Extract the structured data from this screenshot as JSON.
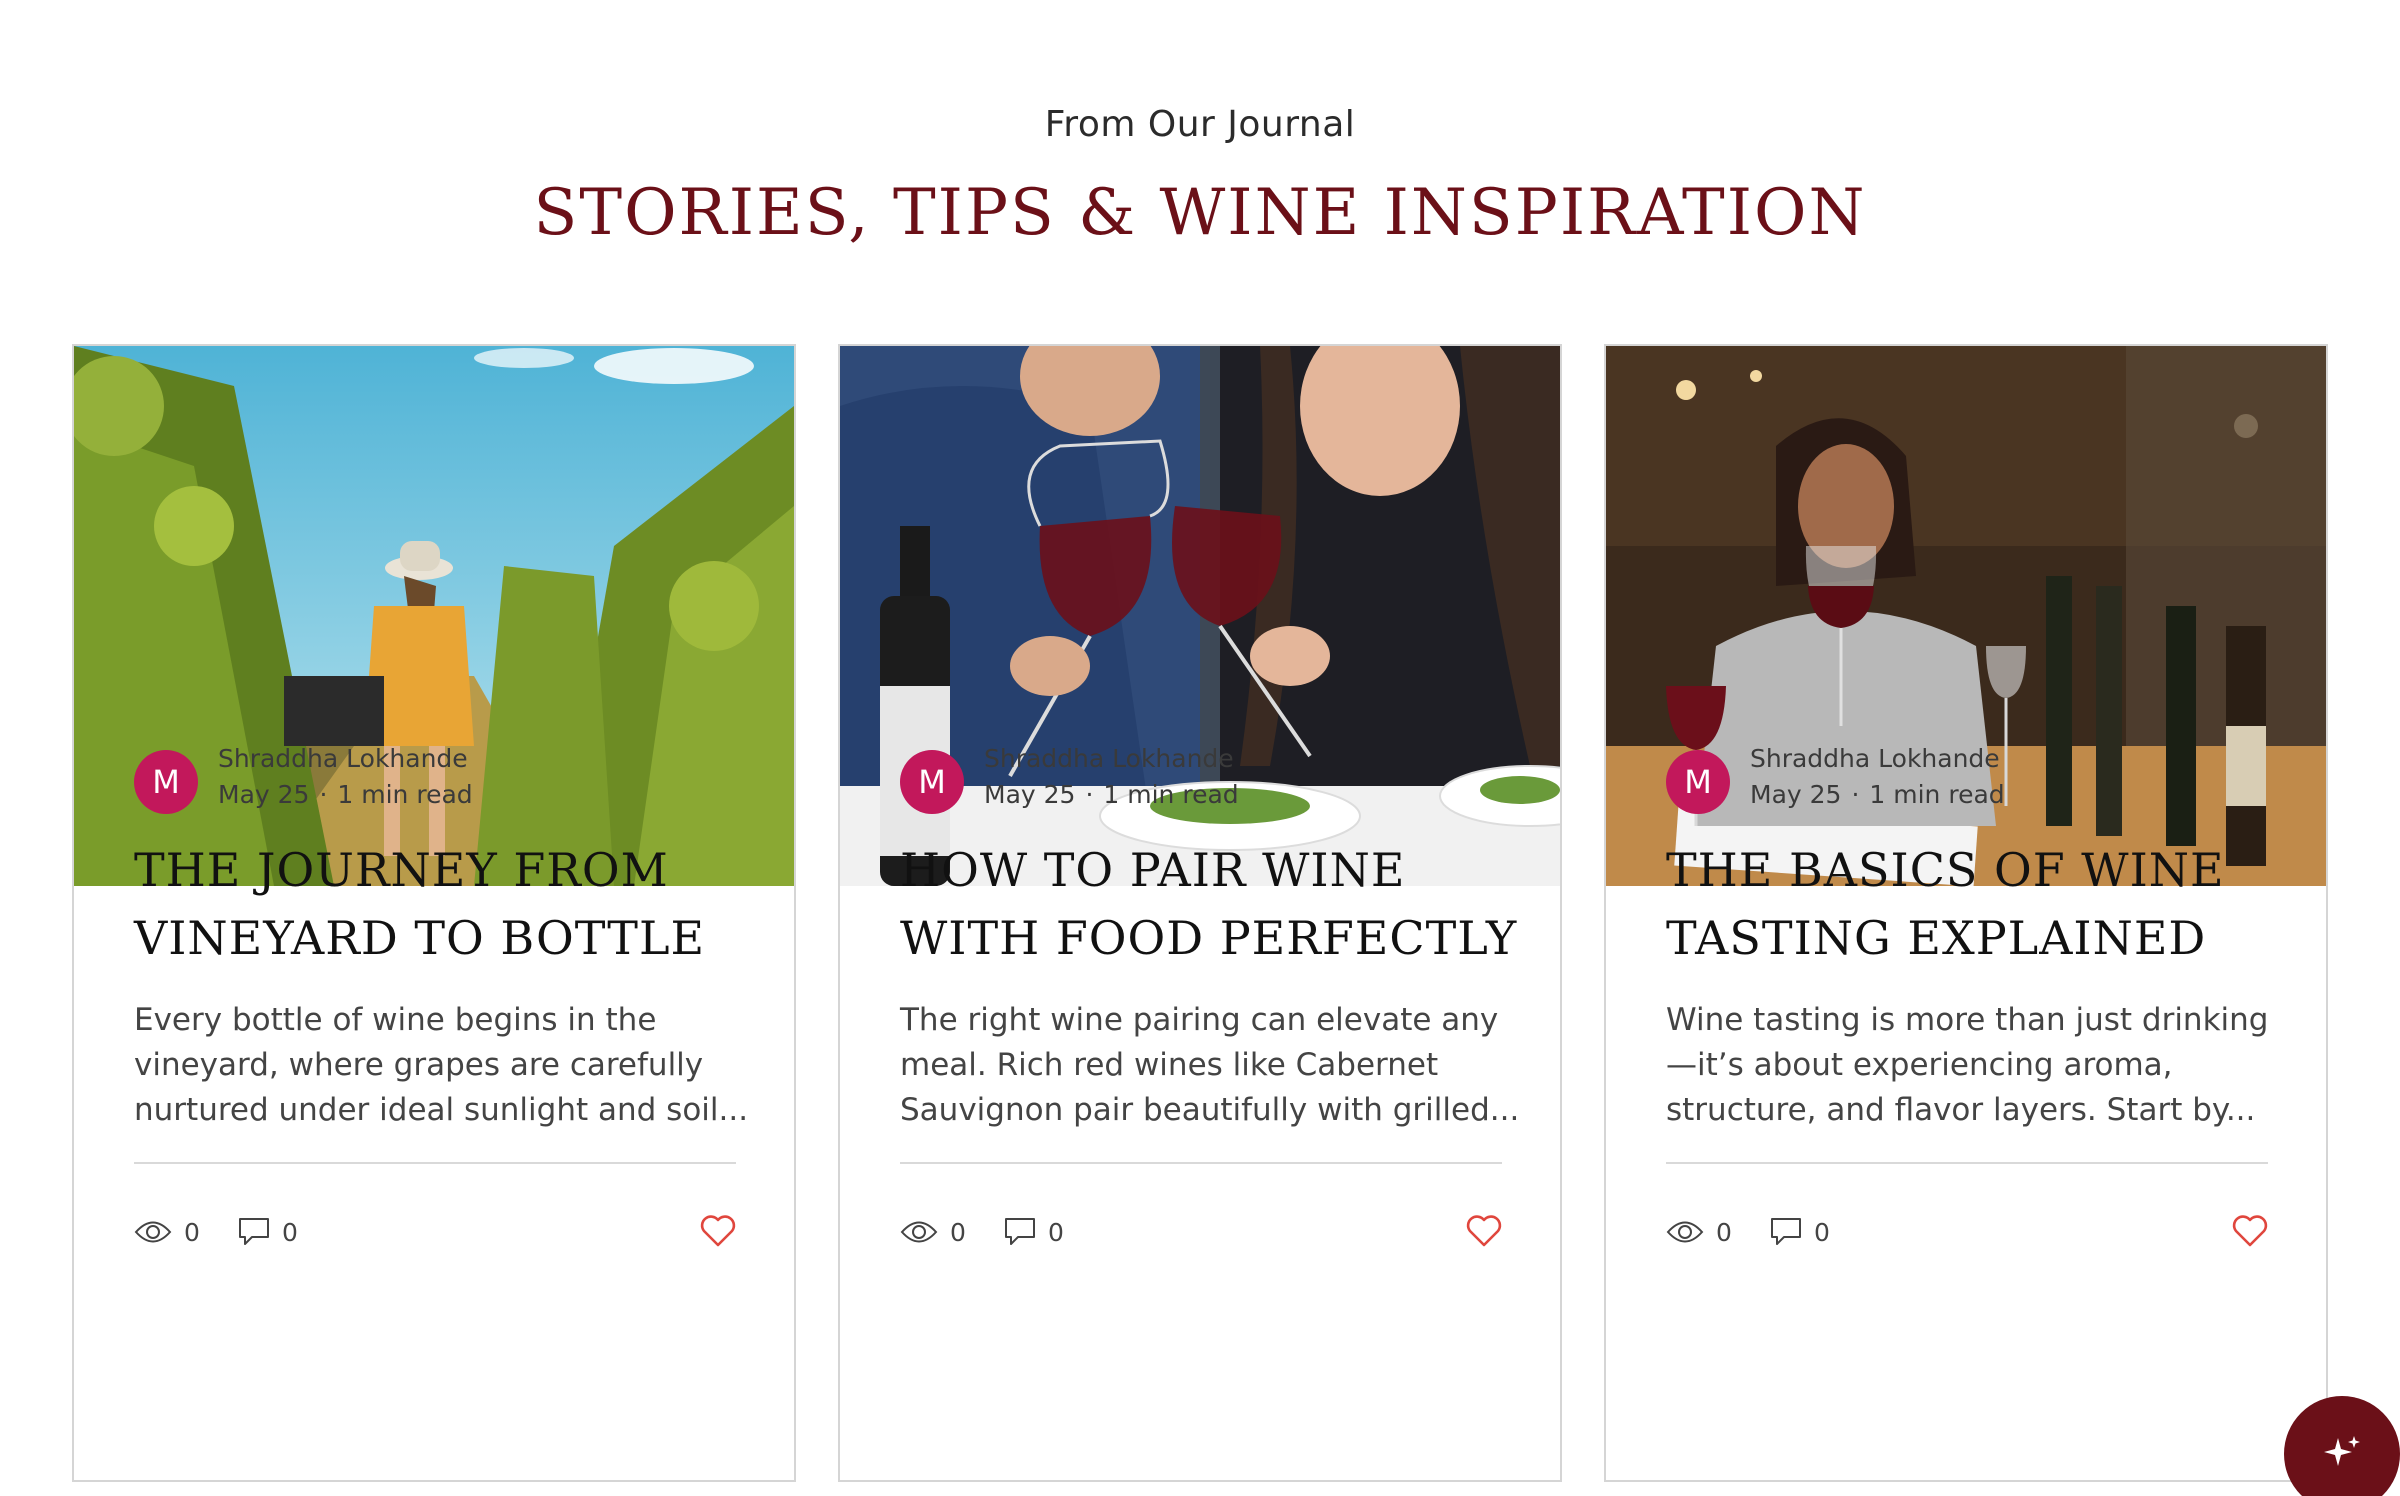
{
  "section": {
    "eyebrow": "From Our Journal",
    "title": "STORIES, TIPS & WINE INSPIRATION"
  },
  "colors": {
    "brand": "#6b1018",
    "avatar": "#c2185b",
    "heart": "#e0463d"
  },
  "posts": [
    {
      "image_alt": "woman walking through vineyard",
      "avatar_initial": "M",
      "author": "Shraddha Lokhande",
      "date": "May 25",
      "read_time": "1 min read",
      "title": "THE JOURNEY FROM VINEYARD TO BOTTLE",
      "excerpt": "Every bottle of wine begins in the vineyard, where grapes are carefully nurtured under ideal sunlight and soil...",
      "views": "0",
      "comments": "0"
    },
    {
      "image_alt": "couple toasting red wine at dinner",
      "avatar_initial": "M",
      "author": "Shraddha Lokhande",
      "date": "May 25",
      "read_time": "1 min read",
      "title": "HOW TO PAIR WINE WITH FOOD PERFECTLY",
      "excerpt": "The right wine pairing can elevate any meal. Rich red wines like Cabernet Sauvignon pair beautifully with grilled...",
      "views": "0",
      "comments": "0"
    },
    {
      "image_alt": "woman tasting red wine at a bar",
      "avatar_initial": "M",
      "author": "Shraddha Lokhande",
      "date": "May 25",
      "read_time": "1 min read",
      "title": "THE BASICS OF WINE TASTING EXPLAINED",
      "excerpt": "Wine tasting is more than just drinking—it’s about experiencing aroma, structure, and flavor layers. Start by...",
      "views": "0",
      "comments": "0"
    }
  ],
  "icons": {
    "views": "eye-icon",
    "comments": "comment-icon",
    "like": "heart-icon",
    "assistant": "sparkle-icon"
  }
}
